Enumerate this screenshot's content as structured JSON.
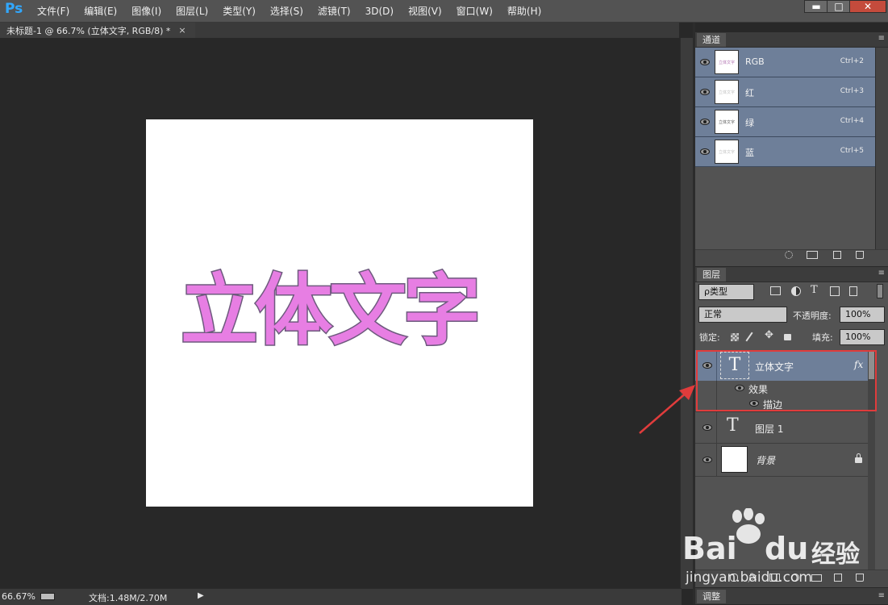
{
  "app": {
    "logo": "Ps"
  },
  "menu": [
    "文件(F)",
    "编辑(E)",
    "图像(I)",
    "图层(L)",
    "类型(Y)",
    "选择(S)",
    "滤镜(T)",
    "3D(D)",
    "视图(V)",
    "窗口(W)",
    "帮助(H)"
  ],
  "window_controls": {
    "minimize": "▬",
    "maximize": "□",
    "close": "✕"
  },
  "document": {
    "tab_title": "未标题-1 @ 66.7% (立体文字, RGB/8) *",
    "tab_close": "×",
    "canvas_text": "立体文字",
    "text_fill": "#e77ee3",
    "text_stroke": "#6e5a7e"
  },
  "status": {
    "zoom": "66.67%",
    "doc_size": "文档:1.48M/2.70M",
    "play": "▶"
  },
  "channels_panel": {
    "tab": "通道",
    "menu_icon": "≡",
    "rows": [
      {
        "name": "RGB",
        "shortcut": "Ctrl+2",
        "thumb_text": "立体文字"
      },
      {
        "name": "红",
        "shortcut": "Ctrl+3",
        "thumb_text": "立体文字"
      },
      {
        "name": "绿",
        "shortcut": "Ctrl+4",
        "thumb_text": "立体文字"
      },
      {
        "name": "蓝",
        "shortcut": "Ctrl+5",
        "thumb_text": "立体文字"
      }
    ]
  },
  "layers_panel": {
    "tab": "图层",
    "menu_icon": "≡",
    "filter_kind": "ρ类型",
    "blend_mode": "正常",
    "opacity_label": "不透明度:",
    "opacity_value": "100%",
    "lock_label": "锁定:",
    "fill_label": "填充:",
    "fill_value": "100%",
    "layers": [
      {
        "thumb": "T",
        "name": "立体文字",
        "fx": "fx",
        "effects_label": "效果",
        "effect": "描边",
        "selected": true
      },
      {
        "thumb": "T",
        "name": "图层 1"
      },
      {
        "thumb": "",
        "name": "背景",
        "locked": true
      }
    ],
    "footer_icons": [
      "link-icon",
      "fx-icon",
      "mask-icon",
      "adjustment-icon",
      "folder-icon",
      "new-layer-icon",
      "trash-icon"
    ]
  },
  "adjust_panel": {
    "tab": "调整"
  },
  "watermark": {
    "brand": "Bai",
    "brand2": "du",
    "cn": "经验",
    "url": "jingyan.baidu.com"
  },
  "colors": {
    "ui_gray": "#535353",
    "selection_blue": "#6e7f99",
    "highlight_red": "#e03c3c",
    "ps_blue": "#31a8ff"
  }
}
